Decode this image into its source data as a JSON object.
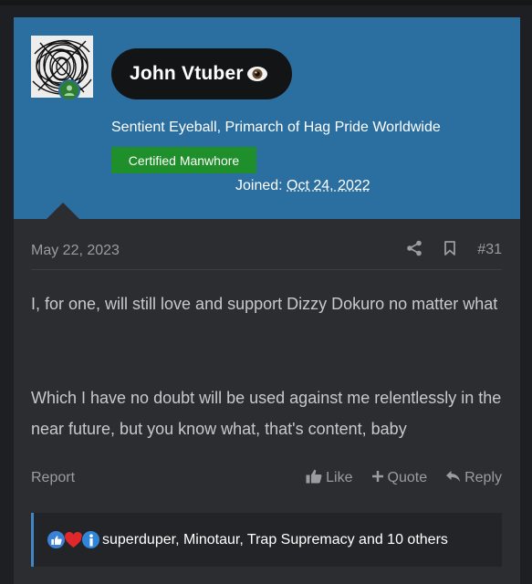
{
  "author": {
    "username": "John Vtuber",
    "user_title": "Sentient Eyeball, Primarch of Hag Pride Worldwide",
    "banner": "Certified Manwhore",
    "joined_label": "Joined:",
    "joined_date": "Oct 24, 2022",
    "status_color": "#2e7d32",
    "banner_color": "#1e8f2a"
  },
  "post": {
    "date": "May 22, 2023",
    "number": "#31",
    "paragraphs": [
      "I, for one, will still love and support Dizzy Dokuro no matter what",
      "Which I have no doubt will be used against me relentlessly in the near future, but you know what, that's content, baby"
    ]
  },
  "footer": {
    "report": "Report",
    "like": "Like",
    "quote": "Quote",
    "reply": "Reply"
  },
  "reactions": {
    "icons": [
      "like-reaction-icon",
      "love-reaction-icon",
      "informative-reaction-icon"
    ],
    "text": "superduper, Minotaur, Trap Supremacy and 10 others"
  },
  "colors": {
    "header_blue": "#2a6fa0",
    "post_bg": "#2b2d31",
    "accent_blue": "#3f88c5"
  }
}
